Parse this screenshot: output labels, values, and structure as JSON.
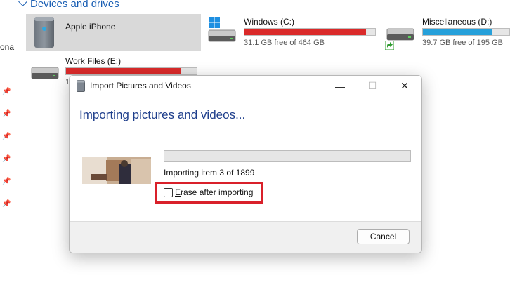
{
  "section": {
    "title": "Devices and drives"
  },
  "nav": {
    "partial_text": "ona"
  },
  "drives": [
    {
      "name": "Apple iPhone"
    },
    {
      "name": "Windows (C:)",
      "free": "31.1 GB free of 464 GB",
      "used_fraction": 0.93,
      "bar_color": "#da2a2a"
    },
    {
      "name": "Miscellaneous  (D:)",
      "free": "39.7 GB free of 195 GB",
      "used_fraction": 0.8,
      "bar_color": "#26a0da"
    },
    {
      "name": "Work Files (E:)",
      "free": "1",
      "used_fraction": 0.88,
      "bar_color": "#da2a2a"
    }
  ],
  "dialog": {
    "title": "Import Pictures and Videos",
    "heading": "Importing pictures and videos...",
    "status": "Importing item 3 of 1899",
    "progress_fraction": 0.0,
    "erase_label": "Erase after importing",
    "erase_checked": false,
    "cancel_label": "Cancel",
    "minimize_glyph": "—",
    "maximize_glyph": "☐",
    "close_glyph": "✕"
  },
  "colors": {
    "accent": "#1a5fb4",
    "highlight": "#d9202a",
    "bar_red": "#da2a2a",
    "bar_blue": "#26a0da"
  }
}
